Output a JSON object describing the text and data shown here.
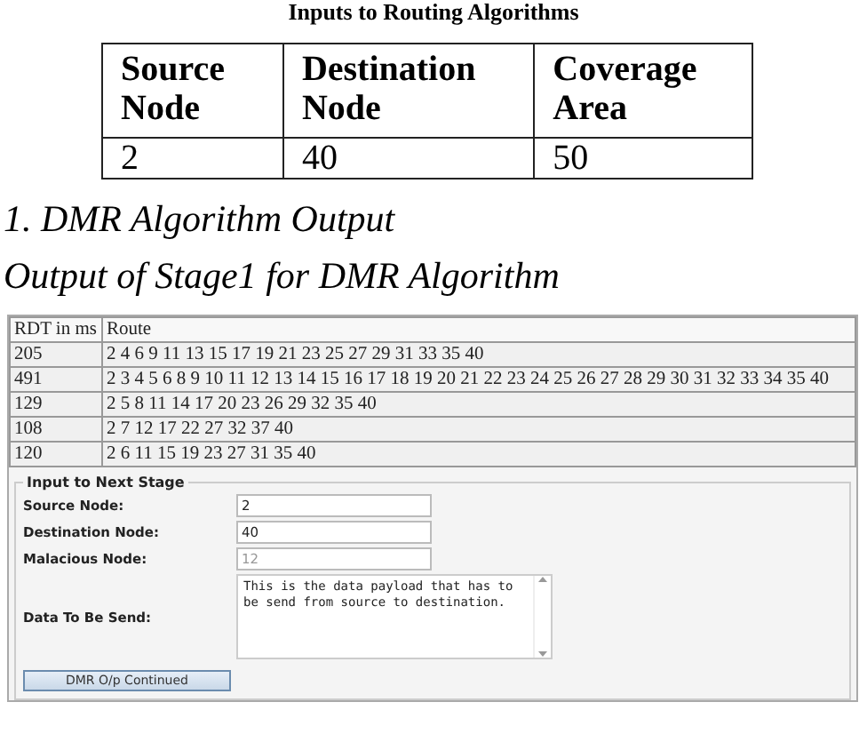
{
  "caption": "Inputs to Routing Algorithms",
  "inputs_table": {
    "columns": [
      "Source Node",
      "Destination Node",
      "Coverage Area"
    ],
    "rows": [
      [
        "2",
        "40",
        "50"
      ]
    ]
  },
  "section_heading": "1. DMR Algorithm Output",
  "figure_caption": "Output of Stage1 for DMR Algorithm",
  "route_table": {
    "columns": [
      "RDT in ms",
      "Route"
    ],
    "rows": [
      [
        "205",
        "2 4 6 9 11 13 15 17 19 21 23 25 27 29 31 33 35 40"
      ],
      [
        "491",
        "2 3 4 5 6 8 9 10 11 12 13 14 15 16 17 18 19 20 21 22 23 24 25 26 27 28 29 30 31 32 33 34 35 40"
      ],
      [
        "129",
        "2 5 8 11 14 17 20 23 26 29 32 35 40"
      ],
      [
        "108",
        "2 7 12 17 22 27 32 37 40"
      ],
      [
        "120",
        "2 6 11 15 19 23 27 31 35 40"
      ]
    ]
  },
  "next_stage": {
    "legend": "Input to Next Stage",
    "fields": [
      {
        "kind": "input",
        "label": "Source Node:",
        "value": "2",
        "disabled": false
      },
      {
        "kind": "input",
        "label": "Destination Node:",
        "value": "40",
        "disabled": false
      },
      {
        "kind": "input",
        "label": "Malacious Node:",
        "value": "12",
        "disabled": true
      },
      {
        "kind": "textarea",
        "label": "Data To Be Send:",
        "value": "This is the data payload that has to be send from source to destination.",
        "disabled": false
      }
    ],
    "button": "DMR O/p Continued"
  }
}
